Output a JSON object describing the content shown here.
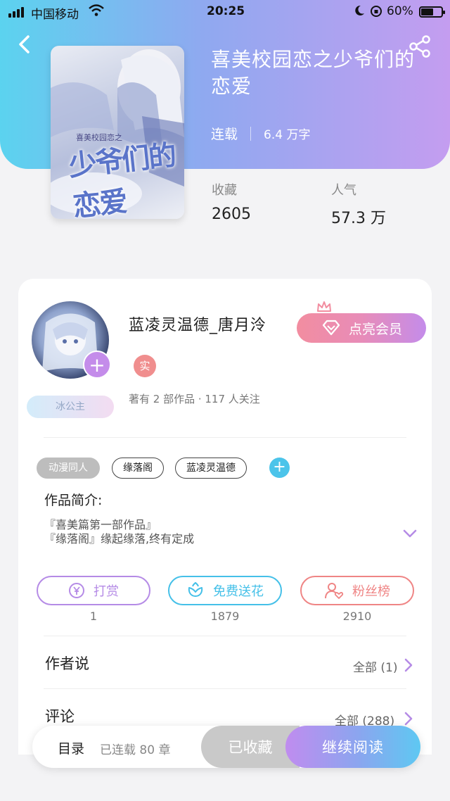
{
  "status_bar": {
    "carrier": "中国移动",
    "time": "20:25",
    "battery": "60%"
  },
  "book": {
    "title": "喜美校园恋之少爷们的恋爱",
    "status": "连载",
    "word_count": "6.4 万字",
    "cover_text": "少爷们的恋爱",
    "cover_small": "喜美校园恋之",
    "stats": [
      {
        "label": "收藏",
        "value": "2605"
      },
      {
        "label": "人气",
        "value": "57.3 万"
      }
    ]
  },
  "author": {
    "name": "蓝凌灵温德_唐月泠",
    "badge": "实",
    "title_badge": "冰公主",
    "meta": "著有 2 部作品 · 117 人关注",
    "vip_button": "点亮会员"
  },
  "tags": [
    "动漫同人",
    "缘落阁",
    "蓝凌灵温德"
  ],
  "intro": {
    "label": "作品简介:",
    "lines": [
      "『喜美篇第一部作品』",
      "『缘落阁』缘起缘落,终有定成"
    ]
  },
  "actions": [
    {
      "label": "打赏",
      "count": "1",
      "color": "#b58be6",
      "icon": "yen-coin-icon"
    },
    {
      "label": "免费送花",
      "count": "1879",
      "color": "#45c0e8",
      "icon": "flower-icon"
    },
    {
      "label": "粉丝榜",
      "count": "2910",
      "color": "#ef8585",
      "icon": "fan-rank-icon"
    }
  ],
  "sections": [
    {
      "title": "作者说",
      "right": "全部 (1)"
    },
    {
      "title": "评论",
      "right": "全部 (288)"
    }
  ],
  "bottom_bar": {
    "catalog": "目录",
    "chapters": "已连载 80 章",
    "favorited": "已收藏",
    "continue": "继续阅读"
  }
}
